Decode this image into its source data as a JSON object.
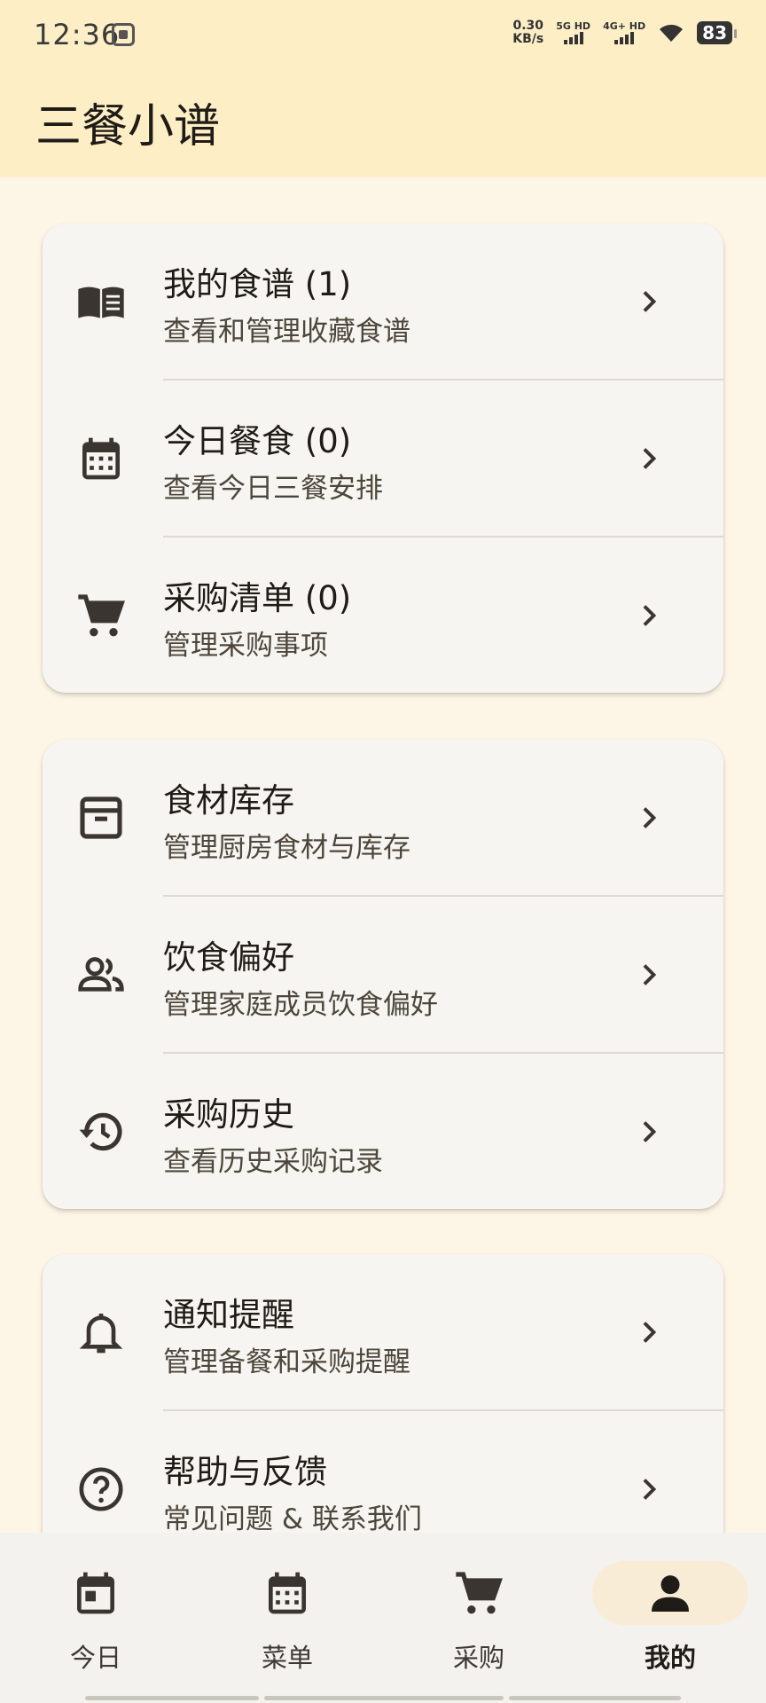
{
  "status_bar": {
    "time": "12:36",
    "speed_value": "0.30",
    "speed_unit": "KB/s",
    "net1": "5G HD",
    "net2": "4G+ HD",
    "battery": "83"
  },
  "app_title": "三餐小谱",
  "groups": [
    {
      "items": [
        {
          "title": "我的食谱 (1)",
          "subtitle": "查看和管理收藏食谱",
          "icon": "recipe-book-icon"
        },
        {
          "title": "今日餐食 (0)",
          "subtitle": "查看今日三餐安排",
          "icon": "calendar-icon"
        },
        {
          "title": "采购清单 (0)",
          "subtitle": "管理采购事项",
          "icon": "cart-icon"
        }
      ]
    },
    {
      "items": [
        {
          "title": "食材库存",
          "subtitle": "管理厨房食材与库存",
          "icon": "archive-box-icon"
        },
        {
          "title": "饮食偏好",
          "subtitle": "管理家庭成员饮食偏好",
          "icon": "people-icon"
        },
        {
          "title": "采购历史",
          "subtitle": "查看历史采购记录",
          "icon": "history-icon"
        }
      ]
    },
    {
      "items": [
        {
          "title": "通知提醒",
          "subtitle": "管理备餐和采购提醒",
          "icon": "bell-icon"
        },
        {
          "title": "帮助与反馈",
          "subtitle": "常见问题 & 联系我们",
          "icon": "help-circle-icon"
        }
      ]
    }
  ],
  "bottom_nav": [
    {
      "label": "今日",
      "icon": "today-calendar-icon",
      "active": false
    },
    {
      "label": "菜单",
      "icon": "menu-calendar-icon",
      "active": false
    },
    {
      "label": "采购",
      "icon": "cart-icon",
      "active": false
    },
    {
      "label": "我的",
      "icon": "person-icon",
      "active": true
    }
  ],
  "colors": {
    "header_bg": "#fdeec6",
    "page_bg": "#fdf5e6",
    "card_bg": "#f7f5f1",
    "active_pill": "#f8ecd6"
  }
}
